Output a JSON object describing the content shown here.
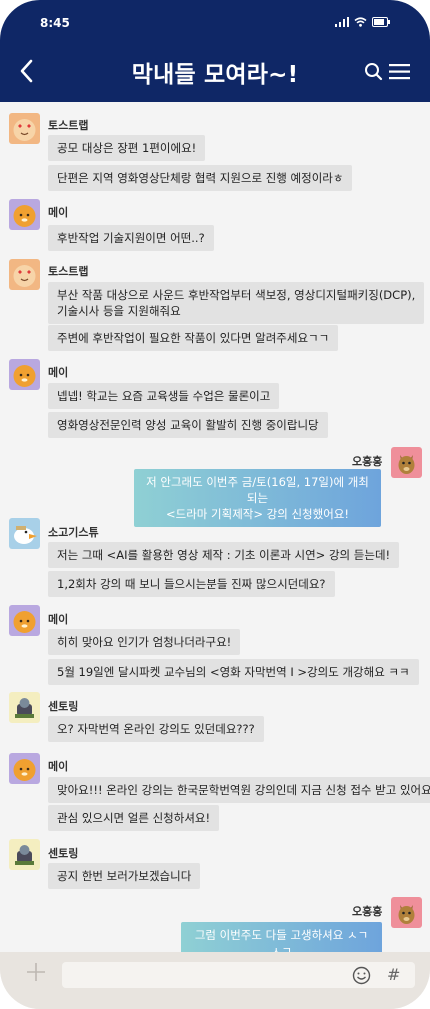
{
  "status": {
    "time": "8:45"
  },
  "header": {
    "title": "막내들 모여라~!"
  },
  "icons": {
    "back": "back-chevron-icon",
    "search": "search-icon",
    "menu": "hamburger-menu-icon",
    "plus": "plus-icon",
    "emoji": "emoji-icon",
    "hash": "hash-icon"
  },
  "senders": {
    "toast": "토스트랩",
    "mei": "메이",
    "oh": "오홍홍",
    "sogo": "소고기스튜",
    "mentor": "센토링"
  },
  "messages": [
    {
      "text": "공모 대상은 장편 1편이에요!"
    },
    {
      "text": "단편은 지역 영화영상단체랑 협력 지원으로 진행 예정이라ㅎ"
    },
    {
      "text": "후반작업 기술지원이면 어떤..?"
    },
    {
      "text": "부산 작품 대상으로 사운드 후반작업부터 색보정, 영상디지털패키징(DCP),",
      "text2": "기술시사 등을 지원해줘요"
    },
    {
      "text": "주변에 후반작업이 필요한 작품이 있다면 알려주세요ㄱㄱ"
    },
    {
      "text": "넵넵! 학교는 요즘 교육생들 수업은 물론이고"
    },
    {
      "text": "영화영상전문인력 양성 교육이 활발히 진행 중이랍니당"
    },
    {
      "text": "저 안그래도 이번주 금/토(16일, 17일)에 개최되는",
      "text2": "<드라마 기획제작> 강의 신청했어요!"
    },
    {
      "text": "저는 그때 <AI를 활용한 영상 제작 : 기초 이론과 시연> 강의 듣는데!"
    },
    {
      "text": "1,2회차 강의 때 보니 들으시는분들 진짜 많으시던데요?"
    },
    {
      "text": "히히 맞아요 인기가 엄청나더라구요!"
    },
    {
      "text": "5월 19일엔 달시파켓 교수님의 <영화 자막번역 I >강의도 개강해요 ㅋㅋ"
    },
    {
      "text": "오? 자막번역 온라인 강의도 있던데요???"
    },
    {
      "text": "맞아요!!! 온라인 강의는 한국문학번역원 강의인데 지금 신청 접수 받고 있어요"
    },
    {
      "text": "관심 있으시면 얼른 신청하셔요!"
    },
    {
      "text": "공지 한번 보러가보겠습니다"
    },
    {
      "text": "그럼 이번주도 다들 고생하셔요 ㅅㄱㅅㄱ"
    }
  ],
  "colors": {
    "header": "#0f2766",
    "chat_bg": "#f4f4f4",
    "bubble": "#e2e2e2",
    "my_bubble": "#7fc3d4"
  }
}
